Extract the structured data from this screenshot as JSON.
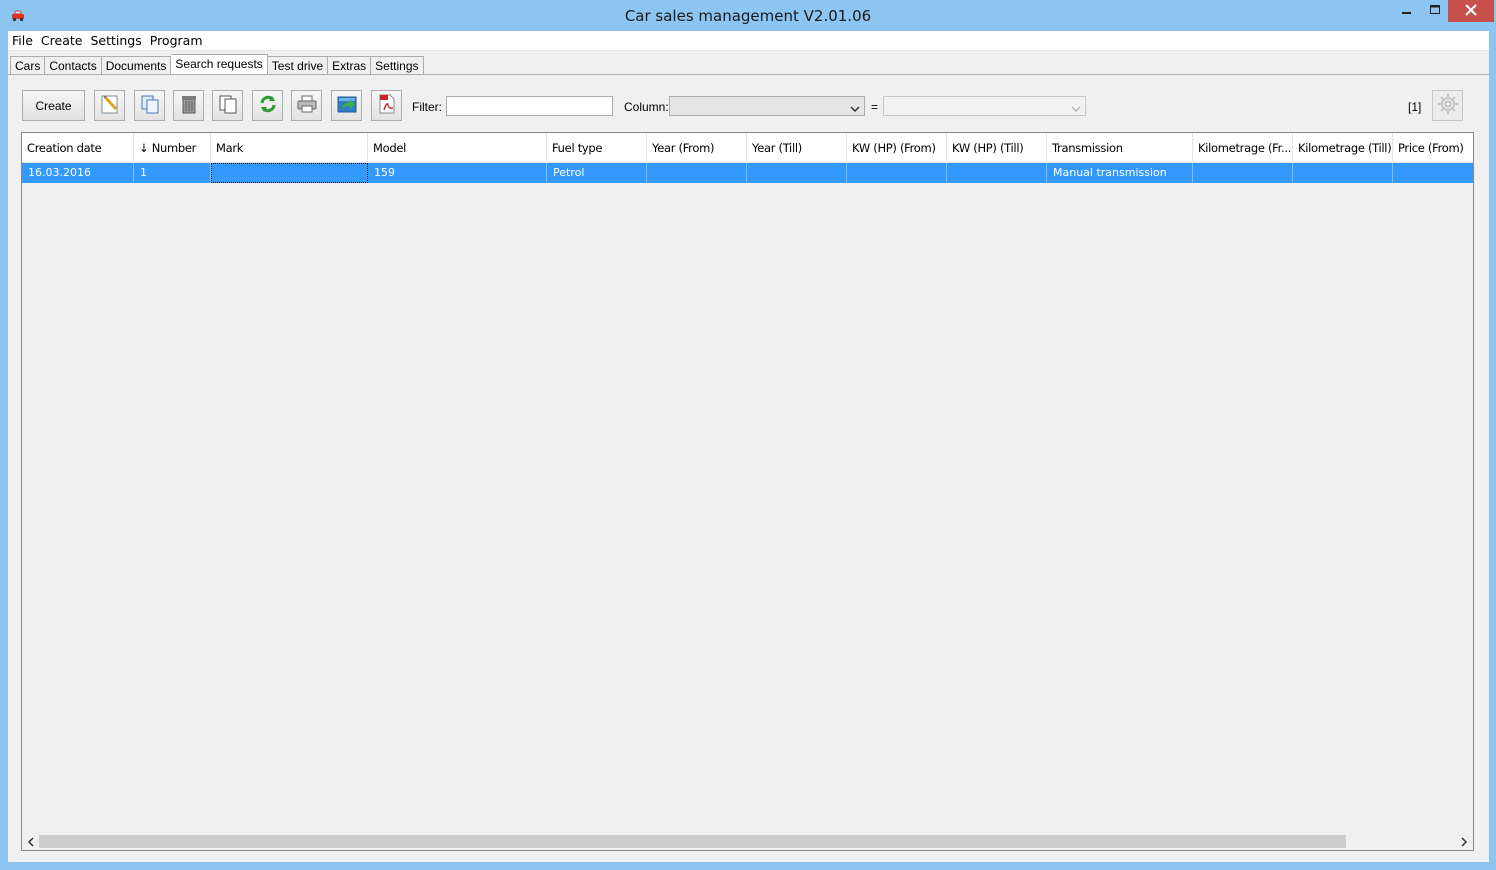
{
  "window": {
    "title": "Car sales management V2.01.06",
    "icon": "car-icon",
    "controls": [
      "minimize-icon",
      "maximize-icon",
      "close-icon"
    ]
  },
  "menu": {
    "items": [
      "File",
      "Create",
      "Settings",
      "Program"
    ]
  },
  "tabs": {
    "items": [
      "Cars",
      "Contacts",
      "Documents",
      "Search requests",
      "Test drive",
      "Extras",
      "Settings"
    ],
    "active": "Search requests"
  },
  "toolbar": {
    "create_label": "Create",
    "icons": [
      "edit-icon",
      "copy-icon",
      "delete-icon",
      "duplicate-icon",
      "refresh-icon",
      "print-icon",
      "export-icon",
      "pdf-icon"
    ],
    "filter_label": "Filter:",
    "filter_value": "",
    "column_label": "Column:",
    "column_value": "",
    "equals": "=",
    "value_select": "",
    "counter": "[1]",
    "settings_icon": "gear-icon"
  },
  "table": {
    "columns": [
      "Creation date",
      "↓ Number",
      "Mark",
      "Model",
      "Fuel type",
      "Year (From)",
      "Year (Till)",
      "KW (HP) (From)",
      "KW (HP) (Till)",
      "Transmission",
      "Kilometrage (Fr...",
      "Kilometrage (Till)",
      "Price (From)"
    ],
    "rows": [
      [
        "16.03.2016",
        "1",
        "",
        "159",
        "Petrol",
        "",
        "",
        "",
        "",
        "Manual transmission",
        "",
        "",
        ""
      ]
    ],
    "selection_color": "#3399ff"
  }
}
